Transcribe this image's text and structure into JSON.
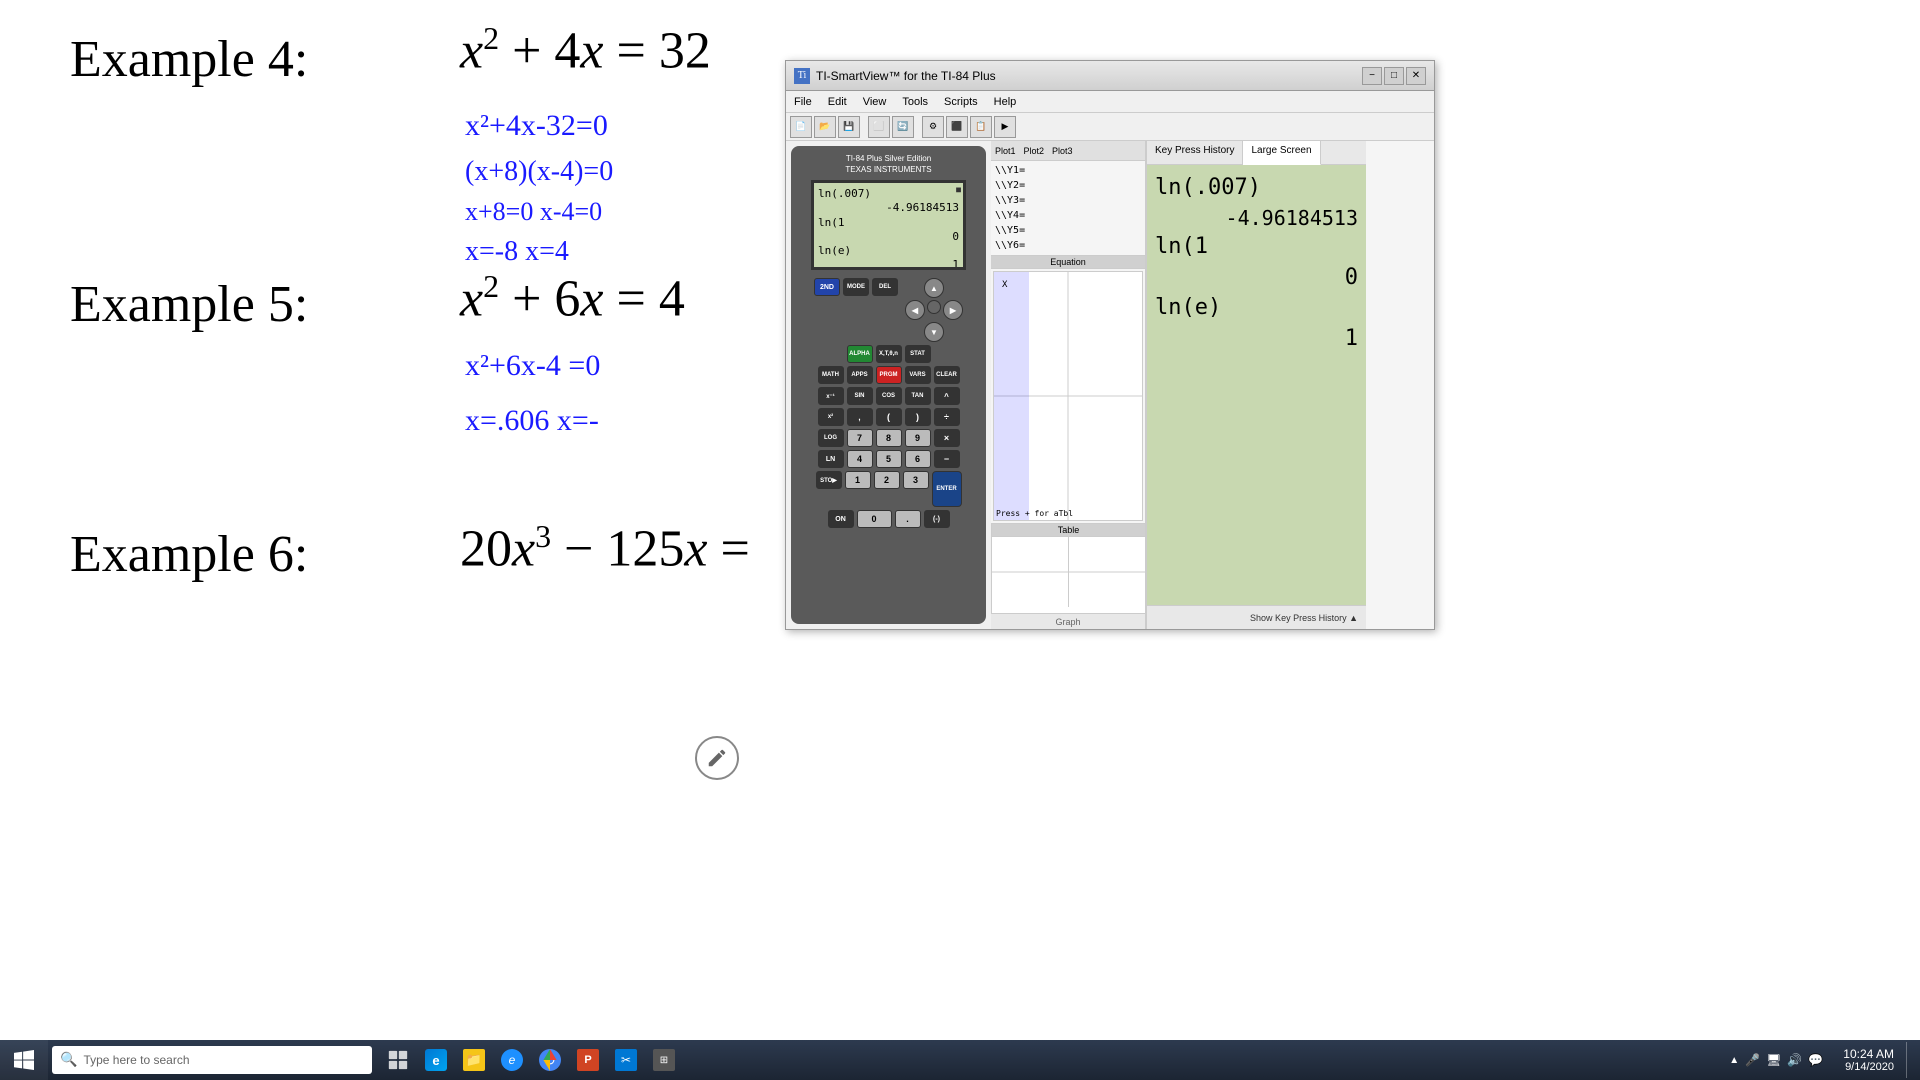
{
  "page": {
    "background": "white"
  },
  "examples": [
    {
      "id": "example4",
      "label": "Example 4:",
      "equation_display": "x² + 4x = 32",
      "handwritten_lines": [
        "x²+4x-32=0",
        "(x+8)(x-4)=0",
        "x+8=0    x-4=0",
        "x=-8      x=4"
      ]
    },
    {
      "id": "example5",
      "label": "Example 5:",
      "equation_display": "x² + 6x = 4",
      "handwritten_lines": [
        "x²+6x-4=0",
        "x=.606   x=-"
      ]
    },
    {
      "id": "example6",
      "label": "Example 6:",
      "equation_display": "20x³ − 125x ="
    }
  ],
  "ti_window": {
    "title": "TI-SmartView™ for the TI-84 Plus",
    "menu_items": [
      "File",
      "Edit",
      "View",
      "Tools",
      "Scripts",
      "Help"
    ],
    "calculator": {
      "brand": "TI-84 Plus Silver Edition",
      "sub_brand": "TEXAS INSTRUMENTS",
      "screen_lines": [
        {
          "text": "ln(.007)",
          "align": "left"
        },
        {
          "text": "-4.96184513",
          "align": "right"
        },
        {
          "text": "ln(1",
          "align": "left"
        },
        {
          "text": "0",
          "align": "right"
        },
        {
          "text": "ln(e)",
          "align": "left"
        },
        {
          "text": "1",
          "align": "right"
        }
      ]
    },
    "large_screen": {
      "lines": [
        {
          "text": "ln(.007)",
          "align": "left"
        },
        {
          "text": "-4.96184513",
          "align": "right"
        },
        {
          "text": "ln(1",
          "align": "left"
        },
        {
          "text": "0",
          "align": "right"
        },
        {
          "text": "ln(e)",
          "align": "left"
        },
        {
          "text": "1",
          "align": "right"
        }
      ]
    },
    "tabs": {
      "key_press_history": "Key Press History",
      "large_screen": "Large Screen"
    },
    "plots_tabs": [
      "Plot1",
      "Plot2",
      "Plot3"
    ],
    "y_vars": [
      "Y1=",
      "Y2=",
      "Y3=",
      "Y4=",
      "Y5=",
      "Y6="
    ],
    "equation_label": "Equation",
    "graph_label": "Graph",
    "table_label": "Table",
    "show_kp_button": "Show Key Press History ▲",
    "press_hint": "Press + for aTbl"
  },
  "taskbar": {
    "search_placeholder": "Type here to search",
    "time": "10:24 AM",
    "date": "9/14/2020",
    "icons": [
      {
        "name": "task-view",
        "symbol": "⊞"
      },
      {
        "name": "edge-browser",
        "symbol": "e"
      },
      {
        "name": "file-explorer",
        "symbol": "📁"
      },
      {
        "name": "ie-browser",
        "symbol": "e"
      },
      {
        "name": "chrome",
        "symbol": "●"
      },
      {
        "name": "powerpoint",
        "symbol": "P"
      },
      {
        "name": "snip-sketch",
        "symbol": "✂"
      },
      {
        "name": "unknown",
        "symbol": "?"
      }
    ]
  }
}
